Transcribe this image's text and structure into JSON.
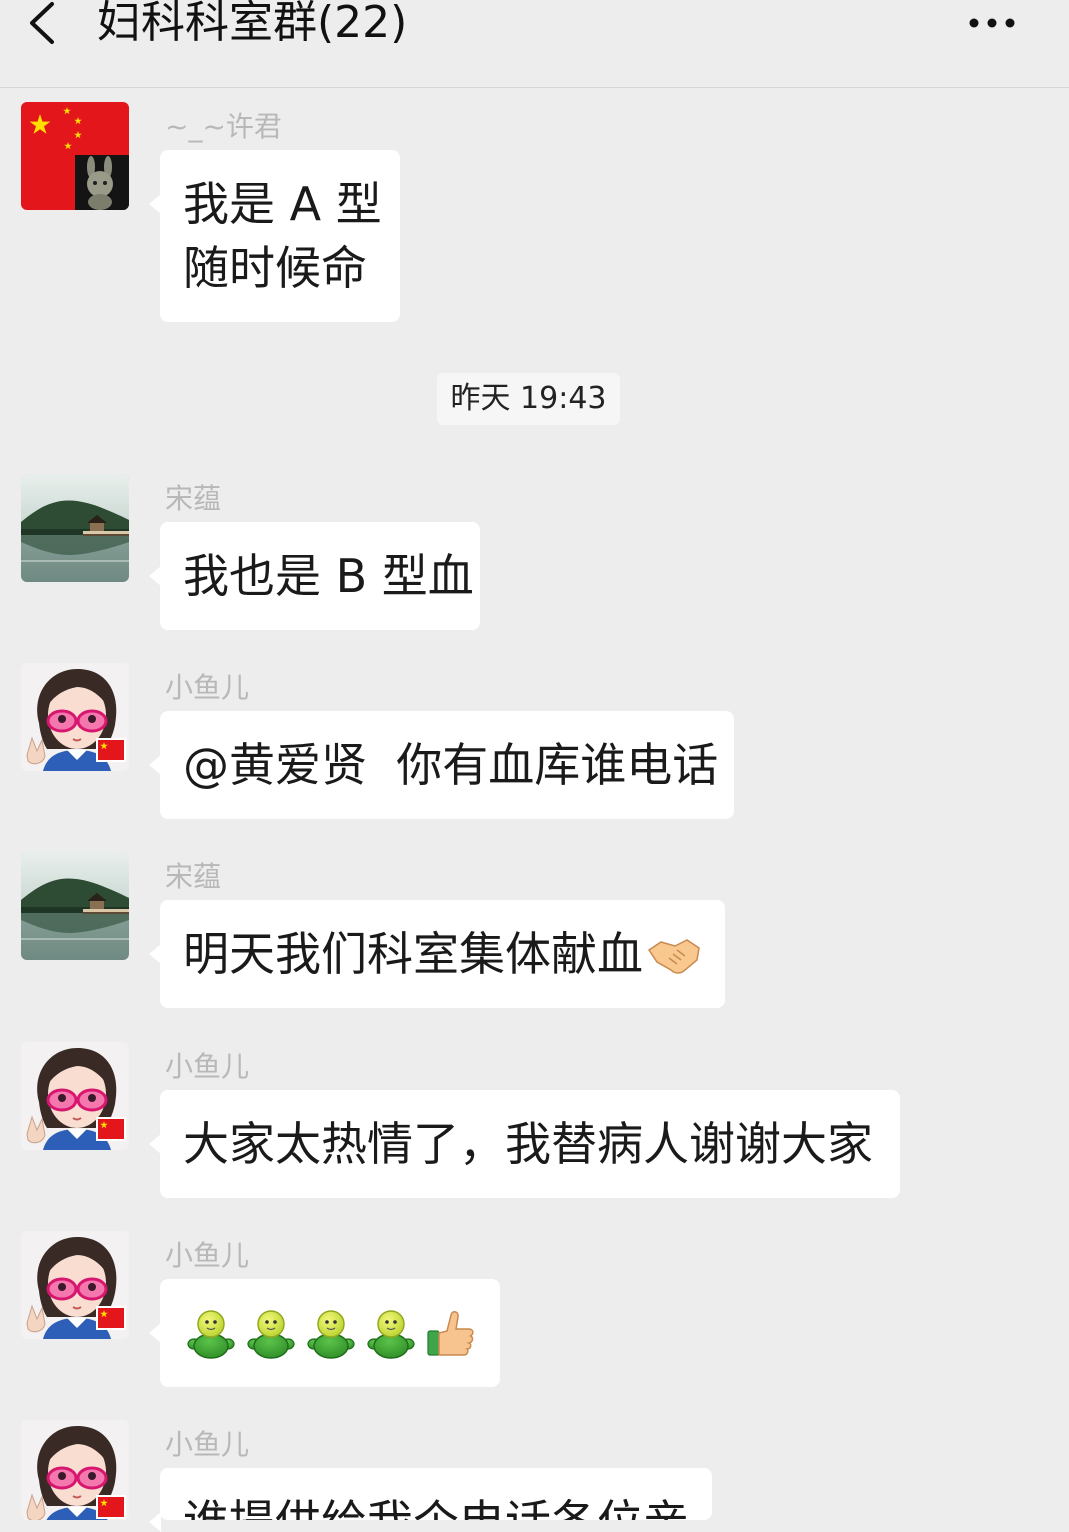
{
  "header": {
    "title": "妇科科室群(22)",
    "back_icon": "chevron-left-icon",
    "more_icon": "more-dots-icon"
  },
  "timestamp": "昨天 19:43",
  "messages": [
    {
      "sender": "~_~许君",
      "avatar": "flag-bunny-avatar",
      "lines": [
        "我是 A 型",
        "随时候命"
      ]
    },
    {
      "sender": "宋蕴",
      "avatar": "lake-landscape-avatar",
      "lines": [
        "我也是 B 型血"
      ]
    },
    {
      "sender": "小鱼儿",
      "avatar": "cartoon-girl-avatar",
      "lines": [
        "@黄爱贤  你有血库谁电话"
      ]
    },
    {
      "sender": "宋蕴",
      "avatar": "lake-landscape-avatar",
      "lines": [
        "明天我们科室集体献血"
      ],
      "emojis": [
        "handshake-emoji"
      ]
    },
    {
      "sender": "小鱼儿",
      "avatar": "cartoon-girl-avatar",
      "lines": [
        "大家太热情了，我替病人谢谢大家"
      ]
    },
    {
      "sender": "小鱼儿",
      "avatar": "cartoon-girl-avatar",
      "emojis": [
        "green-figure-emoji",
        "green-figure-emoji",
        "green-figure-emoji",
        "green-figure-emoji",
        "thumbs-up-emoji"
      ]
    },
    {
      "sender": "小鱼儿",
      "avatar": "cartoon-girl-avatar",
      "lines": [
        "谁提供给我个电话各位亲"
      ]
    }
  ],
  "colors": {
    "page_background": "#ededed",
    "header_border": "#d6d6d6",
    "bubble": "#ffffff",
    "sender_name": "#b8b8b8",
    "message_text": "#1a1a1a",
    "timestamp_background": "#f6f6f6"
  }
}
